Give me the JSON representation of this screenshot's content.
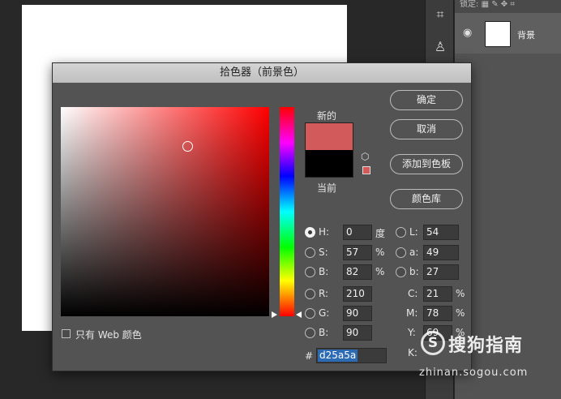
{
  "dialog": {
    "title": "拾色器（前景色）",
    "new_label": "新的",
    "current_label": "当前",
    "new_color": "#d25a5a",
    "current_color": "#000000",
    "buttons": {
      "ok": "确定",
      "cancel": "取消",
      "add_to_swatches": "添加到色板",
      "color_libraries": "颜色库"
    },
    "web_only_label": "只有 Web 颜色",
    "fields": {
      "H": {
        "label": "H:",
        "value": "0",
        "unit": "度",
        "selected": true
      },
      "S": {
        "label": "S:",
        "value": "57",
        "unit": "%"
      },
      "Bv": {
        "label": "B:",
        "value": "82",
        "unit": "%"
      },
      "R": {
        "label": "R:",
        "value": "210"
      },
      "G": {
        "label": "G:",
        "value": "90"
      },
      "Bc": {
        "label": "B:",
        "value": "90"
      },
      "L": {
        "label": "L:",
        "value": "54"
      },
      "a": {
        "label": "a:",
        "value": "49"
      },
      "b": {
        "label": "b:",
        "value": "27"
      },
      "C": {
        "label": "C:",
        "value": "21",
        "unit": "%"
      },
      "M": {
        "label": "M:",
        "value": "78",
        "unit": "%"
      },
      "Y": {
        "label": "Y:",
        "value": "69",
        "unit": "%"
      },
      "K": {
        "label": "K:"
      }
    },
    "hex_prefix": "#",
    "hex_value": "d25a5a"
  },
  "layers_panel": {
    "lock_label": "锁定:",
    "layer_name": "背景"
  },
  "icons": [
    "crop-icon",
    "stamp-icon",
    "eye-icon",
    "cube-icon",
    "lock-transparency-icon",
    "brush-icon",
    "move-icon",
    "artboard-icon"
  ],
  "watermark": {
    "logo_glyph": "S",
    "title": "搜狗指南",
    "url": "zhinan.sogou.com"
  }
}
